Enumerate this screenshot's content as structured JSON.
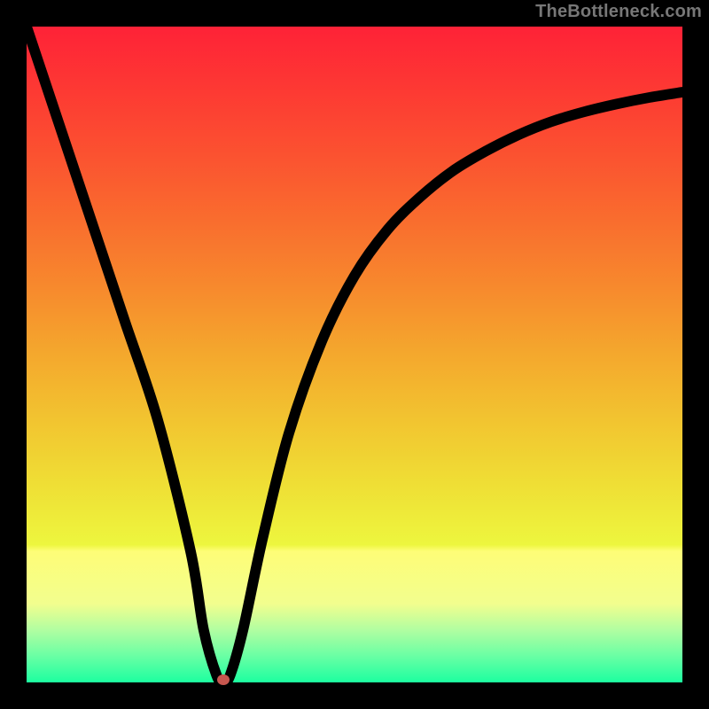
{
  "watermark": "TheBottleneck.com",
  "chart_data": {
    "type": "line",
    "title": "",
    "xlabel": "",
    "ylabel": "",
    "xlim": [
      0,
      100
    ],
    "ylim": [
      0,
      100
    ],
    "grid": false,
    "legend": false,
    "series": [
      {
        "name": "bottleneck-curve",
        "x": [
          0,
          5,
          10,
          15,
          20,
          25,
          27,
          29,
          30,
          31,
          33,
          36,
          40,
          45,
          50,
          55,
          60,
          65,
          70,
          75,
          80,
          85,
          90,
          95,
          100
        ],
        "y": [
          100,
          85,
          70,
          55,
          40,
          20,
          8,
          1,
          0,
          1,
          8,
          22,
          38,
          52,
          62,
          69,
          74,
          78,
          81,
          83.5,
          85.5,
          87,
          88.2,
          89.2,
          90
        ]
      }
    ],
    "marker": {
      "x": 30,
      "y": 0,
      "color": "#c7574f"
    },
    "gradient_stops": [
      {
        "pos": 0.0,
        "color": "#fe2237"
      },
      {
        "pos": 0.1,
        "color": "#fd3a33"
      },
      {
        "pos": 0.2,
        "color": "#fb5330"
      },
      {
        "pos": 0.3,
        "color": "#f96e2e"
      },
      {
        "pos": 0.4,
        "color": "#f78a2d"
      },
      {
        "pos": 0.5,
        "color": "#f4a82d"
      },
      {
        "pos": 0.6,
        "color": "#f2c430"
      },
      {
        "pos": 0.7,
        "color": "#efdf35"
      },
      {
        "pos": 0.79,
        "color": "#edf63e"
      },
      {
        "pos": 0.8,
        "color": "#fefd77"
      },
      {
        "pos": 0.88,
        "color": "#f2fe8e"
      },
      {
        "pos": 0.92,
        "color": "#b1fea1"
      },
      {
        "pos": 0.96,
        "color": "#69ffa4"
      },
      {
        "pos": 1.0,
        "color": "#1cffa0"
      }
    ]
  }
}
